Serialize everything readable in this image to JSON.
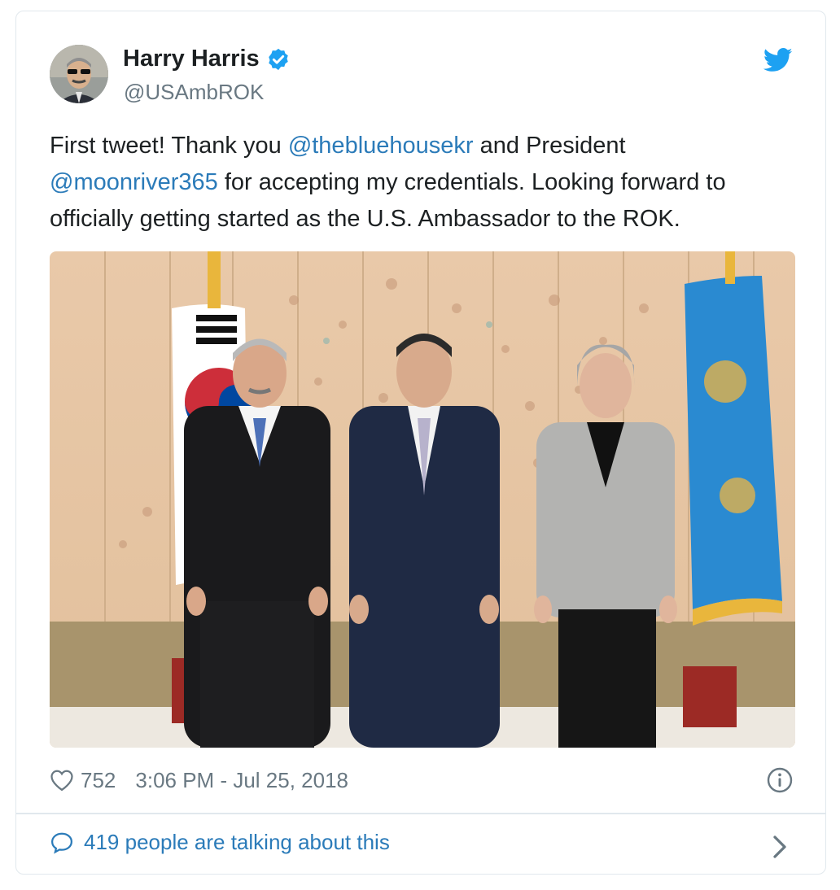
{
  "tweet": {
    "author_name": "Harry Harris",
    "author_handle": "@USAmbROK",
    "verified": true,
    "text_parts": [
      "First tweet! Thank you ",
      "@thebluehousekr",
      " and President ",
      "@moonriver365",
      " for accepting my credentials. Looking forward to officially getting started as the U.S. Ambassador to the ROK."
    ],
    "likes": "752",
    "timestamp": "3:06 PM - Jul 25, 2018",
    "talking": "419 people are talking about this"
  },
  "icons": {
    "verified": "verified-badge-icon",
    "bird": "twitter-bird-icon",
    "heart": "heart-icon",
    "info": "info-icon",
    "comment": "comment-bubble-icon",
    "chevron": "chevron-right-icon"
  },
  "colors": {
    "link": "#2b7bb9",
    "twitter_blue": "#1da1f2",
    "muted": "#697882",
    "border": "#e1e8ed"
  }
}
